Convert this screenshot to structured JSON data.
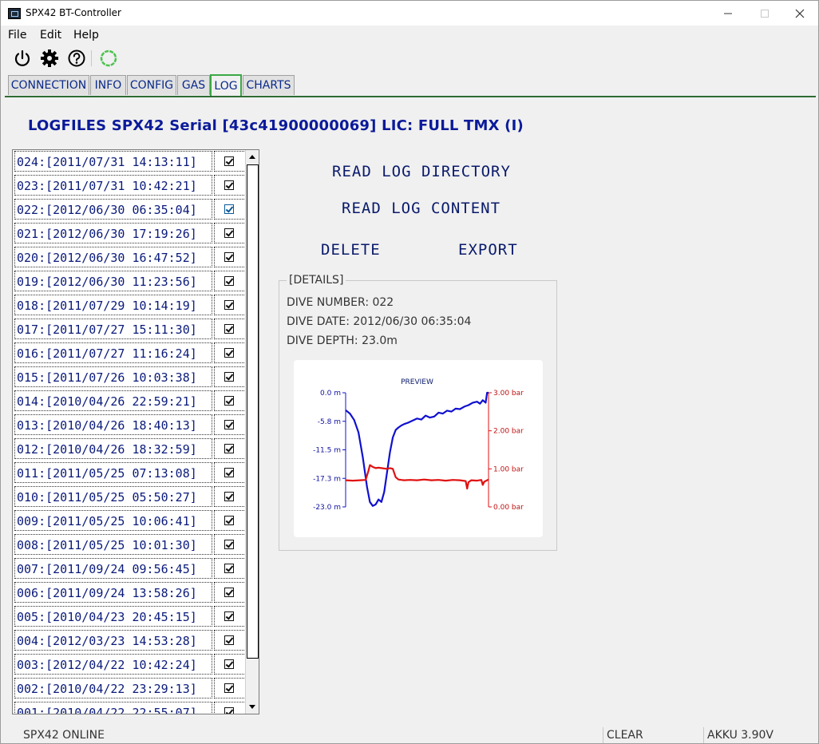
{
  "window": {
    "title": "SPX42 BT-Controller"
  },
  "menu": {
    "file": "File",
    "edit": "Edit",
    "help": "Help"
  },
  "toolbar": {
    "icons": [
      "power-icon",
      "gear-icon",
      "help-icon",
      "connection-status-ring-icon"
    ]
  },
  "tabs": [
    {
      "label": "CONNECTION",
      "active": false
    },
    {
      "label": "INFO",
      "active": false
    },
    {
      "label": "CONFIG",
      "active": false
    },
    {
      "label": "GAS",
      "active": false
    },
    {
      "label": "LOG",
      "active": true
    },
    {
      "label": "CHARTS",
      "active": false
    }
  ],
  "heading": "LOGFILES SPX42 Serial [43c41900000069] LIC: FULL TMX (I)",
  "logs": [
    {
      "label": "024:[2011/07/31 14:13:11]",
      "checked": true
    },
    {
      "label": "023:[2011/07/31 10:42:21]",
      "checked": true
    },
    {
      "label": "022:[2012/06/30 06:35:04]",
      "checked": true,
      "selected": true
    },
    {
      "label": "021:[2012/06/30 17:19:26]",
      "checked": true
    },
    {
      "label": "020:[2012/06/30 16:47:52]",
      "checked": true
    },
    {
      "label": "019:[2012/06/30 11:23:56]",
      "checked": true
    },
    {
      "label": "018:[2011/07/29 10:14:19]",
      "checked": true
    },
    {
      "label": "017:[2011/07/27 15:11:30]",
      "checked": true
    },
    {
      "label": "016:[2011/07/27 11:16:24]",
      "checked": true
    },
    {
      "label": "015:[2011/07/26 10:03:38]",
      "checked": true
    },
    {
      "label": "014:[2010/04/26 22:59:21]",
      "checked": true
    },
    {
      "label": "013:[2010/04/26 18:40:13]",
      "checked": true
    },
    {
      "label": "012:[2010/04/26 18:32:59]",
      "checked": true
    },
    {
      "label": "011:[2011/05/25 07:13:08]",
      "checked": true
    },
    {
      "label": "010:[2011/05/25 05:50:27]",
      "checked": true
    },
    {
      "label": "009:[2011/05/25 10:06:41]",
      "checked": true
    },
    {
      "label": "008:[2011/05/25 10:01:30]",
      "checked": true
    },
    {
      "label": "007:[2011/09/24 09:56:45]",
      "checked": true
    },
    {
      "label": "006:[2011/09/24 13:58:26]",
      "checked": true
    },
    {
      "label": "005:[2010/04/23 20:45:15]",
      "checked": true
    },
    {
      "label": "004:[2012/03/23 14:53:28]",
      "checked": true
    },
    {
      "label": "003:[2012/04/22 10:42:24]",
      "checked": true
    },
    {
      "label": "002:[2010/04/22 23:29:13]",
      "checked": true
    },
    {
      "label": "001:[2010/04/22 22:55:07]",
      "checked": true
    }
  ],
  "actions": {
    "read_directory": "READ LOG DIRECTORY",
    "read_content": "READ LOG CONTENT",
    "delete": "DELETE",
    "export": "EXPORT"
  },
  "details": {
    "legend": "[DETAILS]",
    "dive_number": "DIVE NUMBER: 022",
    "dive_date": "DIVE DATE: 2012/06/30 06:35:04",
    "dive_depth": "DIVE DEPTH: 23.0m"
  },
  "colors": {
    "depth": "#1010d0",
    "ppo2": "#e01010",
    "accent": "#0a1a9a"
  },
  "chart_data": {
    "type": "line",
    "title": "PREVIEW",
    "y_left_ticks": [
      "0.0 m",
      "-5.8 m",
      "-11.5 m",
      "-17.3 m",
      "-23.0 m"
    ],
    "y_right_ticks": [
      "3.00 bar",
      "2.00 bar",
      "1.00 bar",
      "0.00 bar"
    ],
    "y_left_range": [
      -23.0,
      0.0
    ],
    "y_right_range": [
      0.0,
      3.0
    ],
    "x_range": [
      0,
      100
    ],
    "series": [
      {
        "axis": "left",
        "color": "#1010d0",
        "x": [
          0,
          3,
          6,
          9,
          12,
          15,
          17,
          19,
          21,
          23,
          25,
          27,
          29,
          31,
          33,
          35,
          37,
          39,
          41,
          44,
          47,
          50,
          53,
          56,
          59,
          62,
          65,
          68,
          71,
          74,
          77,
          80,
          83,
          86,
          89,
          92,
          94,
          96,
          98,
          99,
          100
        ],
        "y": [
          -3.5,
          -4.2,
          -5.5,
          -8.0,
          -13.0,
          -19.0,
          -22.0,
          -22.8,
          -22.5,
          -21.5,
          -22.0,
          -20.0,
          -16.0,
          -12.0,
          -9.0,
          -7.5,
          -7.0,
          -6.6,
          -6.3,
          -6.0,
          -5.6,
          -5.2,
          -5.4,
          -4.6,
          -5.0,
          -4.8,
          -4.0,
          -4.2,
          -3.6,
          -3.8,
          -3.2,
          -3.3,
          -2.8,
          -2.5,
          -2.0,
          -1.8,
          -2.2,
          -1.5,
          -2.0,
          0.0,
          0.0
        ]
      },
      {
        "axis": "right",
        "color": "#e01010",
        "x": [
          0,
          5,
          10,
          14,
          16,
          17,
          19,
          21,
          23,
          25,
          27,
          29,
          31,
          33,
          35,
          37,
          39,
          41,
          45,
          50,
          55,
          60,
          65,
          70,
          75,
          80,
          84,
          85,
          86,
          88,
          92,
          95,
          96,
          97,
          100
        ],
        "y": [
          0.7,
          0.69,
          0.7,
          0.71,
          0.95,
          1.1,
          1.05,
          1.02,
          1.03,
          1.02,
          1.01,
          1.0,
          1.02,
          1.0,
          0.78,
          0.72,
          0.71,
          0.7,
          0.71,
          0.7,
          0.72,
          0.7,
          0.71,
          0.69,
          0.71,
          0.7,
          0.68,
          0.48,
          0.65,
          0.7,
          0.69,
          0.71,
          0.58,
          0.66,
          0.72
        ]
      }
    ]
  },
  "status": {
    "connection": "SPX42 ONLINE",
    "clear": "CLEAR",
    "battery": "AKKU 3.90V"
  }
}
